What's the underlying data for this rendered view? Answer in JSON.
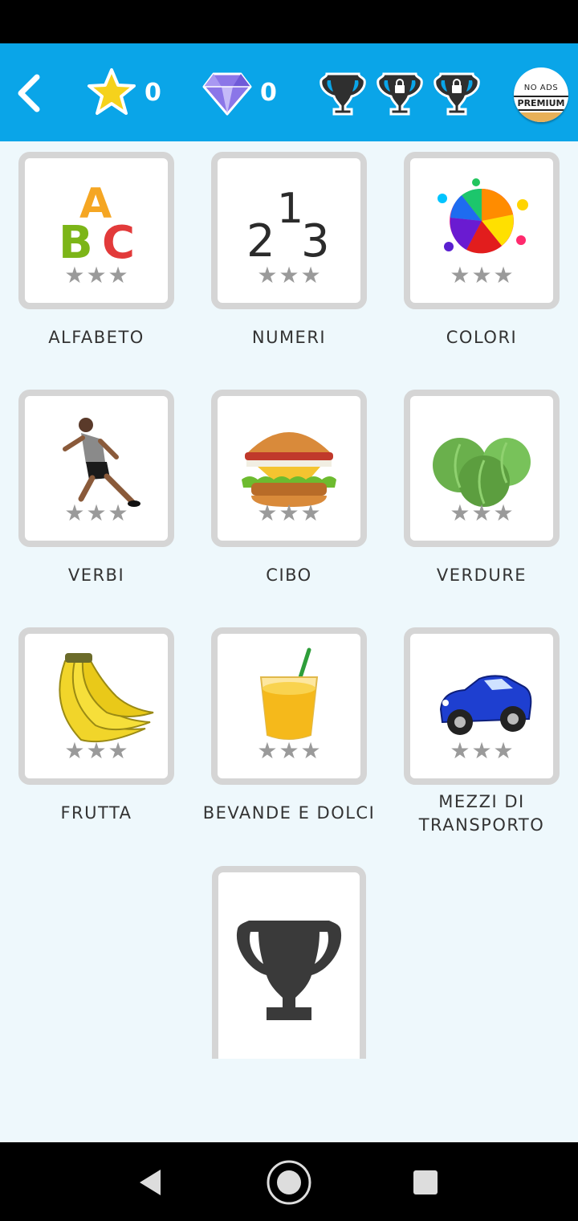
{
  "header": {
    "stars_count": "0",
    "gems_count": "0",
    "premium_line1": "NO ADS",
    "premium_line2": "PREMIUM"
  },
  "icons": {
    "back": "chevron-left-icon",
    "star": "star-icon",
    "gem": "diamond-icon",
    "trophy": "trophy-icon",
    "locked_trophy": "trophy-lock-icon"
  },
  "categories": [
    {
      "label": "ALFABETO",
      "icon": "abc-letters-icon",
      "stars": 0
    },
    {
      "label": "NUMERI",
      "icon": "numbers-213-icon",
      "stars": 0
    },
    {
      "label": "COLORI",
      "icon": "paint-splash-icon",
      "stars": 0
    },
    {
      "label": "VERBI",
      "icon": "running-man-icon",
      "stars": 0
    },
    {
      "label": "CIBO",
      "icon": "burger-icon",
      "stars": 0
    },
    {
      "label": "VERDURE",
      "icon": "cabbage-icon",
      "stars": 0
    },
    {
      "label": "FRUTTA",
      "icon": "banana-icon",
      "stars": 0
    },
    {
      "label": "BEVANDE E DOLCI",
      "icon": "juice-glass-icon",
      "stars": 0
    },
    {
      "label": "MEZZI DI TRANSPORTO",
      "icon": "blue-car-icon",
      "stars": 0
    }
  ],
  "colors": {
    "header_bg": "#0aa5e8",
    "page_bg": "#eef8fc",
    "card_border": "#d5d5d5",
    "star_gold": "#f5d21c",
    "gem_purple": "#8b76e8",
    "trophy_dark": "#3a3a3a"
  }
}
